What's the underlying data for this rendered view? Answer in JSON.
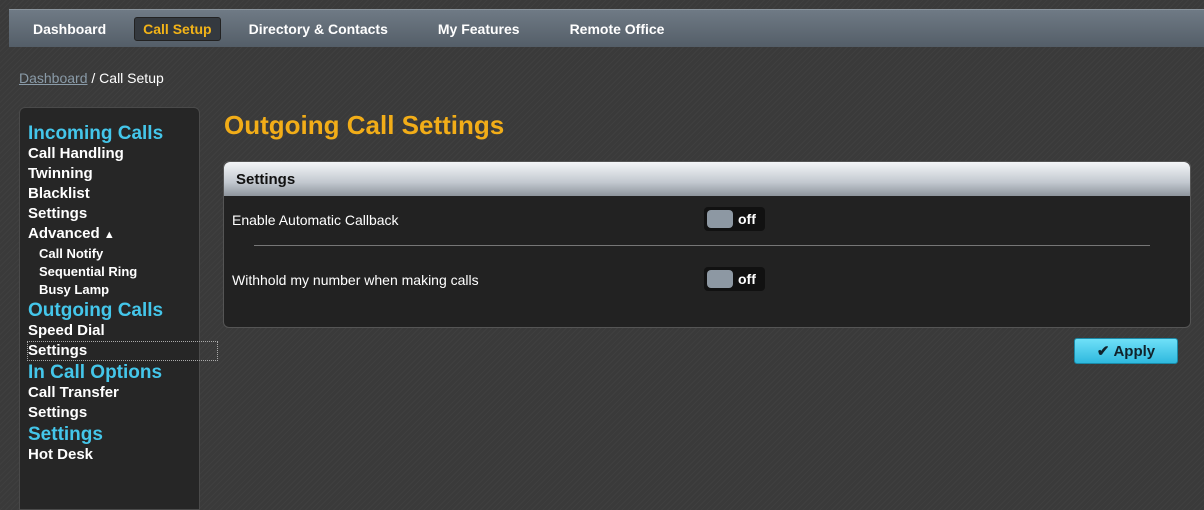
{
  "nav": {
    "items": [
      "Dashboard",
      "Call Setup",
      "Directory & Contacts",
      "My Features",
      "Remote Office"
    ],
    "active_index": 1
  },
  "breadcrumb": {
    "link": "Dashboard",
    "separator": " / ",
    "current": "Call Setup"
  },
  "sidebar": {
    "incoming_title": "Incoming Calls",
    "incoming_items": [
      "Call Handling",
      "Twinning",
      "Blacklist",
      "Settings"
    ],
    "advanced_label": "Advanced",
    "advanced_caret": "▲",
    "advanced_items": [
      "Call Notify",
      "Sequential Ring",
      "Busy Lamp"
    ],
    "outgoing_title": "Outgoing Calls",
    "outgoing_items": [
      "Speed Dial",
      "Settings"
    ],
    "incall_title": "In Call Options",
    "incall_items": [
      "Call Transfer",
      "Settings"
    ],
    "settings_title": "Settings",
    "settings_items": [
      "Hot Desk"
    ]
  },
  "page": {
    "title": "Outgoing Call Settings"
  },
  "panel": {
    "header": "Settings",
    "rows": [
      {
        "label": "Enable Automatic Callback",
        "toggle": "off"
      },
      {
        "label": "Withhold my number when making calls",
        "toggle": "off"
      }
    ]
  },
  "apply_button": {
    "icon": "✔",
    "label": "Apply"
  },
  "colors": {
    "accent_orange": "#f2ad18",
    "accent_cyan": "#44c6ea",
    "background": "#3a3a3a"
  }
}
